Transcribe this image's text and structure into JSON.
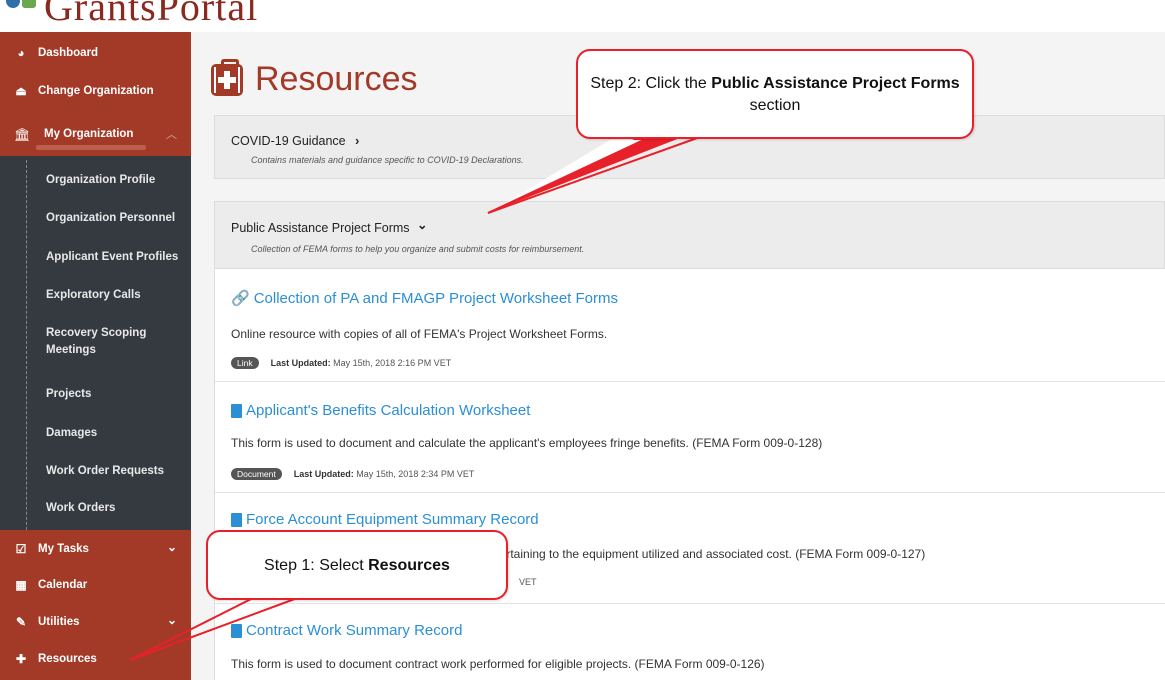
{
  "brand": {
    "title": "GrantsPortal"
  },
  "sidebar": {
    "top_items": [
      {
        "label": "Dashboard",
        "icon": "dashboard-icon",
        "glyph": "◕"
      },
      {
        "label": "Change Organization",
        "icon": "eject-icon",
        "glyph": "⏏"
      }
    ],
    "my_org": {
      "label": "My Organization",
      "icon": "bank-icon",
      "glyph": "🏛"
    },
    "sub_items": [
      {
        "label": "Organization Profile"
      },
      {
        "label": "Organization Personnel"
      },
      {
        "label": "Applicant Event Profiles"
      },
      {
        "label": "Exploratory Calls"
      },
      {
        "label": "Recovery Scoping Meetings"
      },
      {
        "label": "Projects"
      },
      {
        "label": "Damages"
      },
      {
        "label": "Work Order Requests"
      },
      {
        "label": "Work Orders"
      }
    ],
    "bottom_items": [
      {
        "label": "My Tasks",
        "icon": "checkbox-icon",
        "glyph": "☑",
        "chevron": true
      },
      {
        "label": "Calendar",
        "icon": "calendar-icon",
        "glyph": "▦",
        "chevron": false
      },
      {
        "label": "Utilities",
        "icon": "wrench-icon",
        "glyph": "✎",
        "chevron": true
      },
      {
        "label": "Resources",
        "icon": "first-aid-icon",
        "glyph": "✚",
        "chevron": false
      }
    ],
    "colors": {
      "accent": "#a33a27",
      "dark": "#343a40"
    }
  },
  "main": {
    "title": "Resources",
    "sections": [
      {
        "title": "COVID-19 Guidance",
        "chevron": "›",
        "description": "Contains materials and guidance specific to COVID-19 Declarations."
      },
      {
        "title": "Public Assistance Project Forms",
        "chevron": "⌄",
        "description": "Collection of FEMA forms to help you organize and submit costs for reimbursement."
      }
    ],
    "resources": [
      {
        "title": "Collection of PA and FMAGP Project Worksheet Forms",
        "type_icon": "link-icon",
        "description": "Online resource with copies of all of FEMA's Project Worksheet Forms.",
        "badge": "Link",
        "updated_label": "Last Updated:",
        "updated_value": "May 15th, 2018 2:16 PM VET"
      },
      {
        "title": "Applicant's Benefits Calculation Worksheet",
        "type_icon": "document-icon",
        "description": "This form is used to document and calculate the applicant's employees fringe benefits. (FEMA Form 009-0-128)",
        "badge": "Document",
        "updated_label": "Last Updated:",
        "updated_value": "May 15th, 2018 2:34 PM VET"
      },
      {
        "title": "Force Account Equipment Summary Record",
        "type_icon": "document-icon",
        "description": "pertaining to the equipment utilized and associated cost. (FEMA Form 009-0-127)",
        "badge": "",
        "updated_label": "",
        "updated_value": "VET"
      },
      {
        "title": "Contract Work Summary Record",
        "type_icon": "document-icon",
        "description": "This form is used to document contract work performed for eligible projects. (FEMA Form 009-0-126)",
        "badge": "",
        "updated_label": "",
        "updated_value": ""
      }
    ]
  },
  "callouts": {
    "step1_prefix": "Step 1: Select ",
    "step1_bold": "Resources",
    "step2_prefix": "Step 2: Click the ",
    "step2_bold": "Public Assistance Project Forms",
    "step2_suffix": " section",
    "color": "#e8202a"
  }
}
